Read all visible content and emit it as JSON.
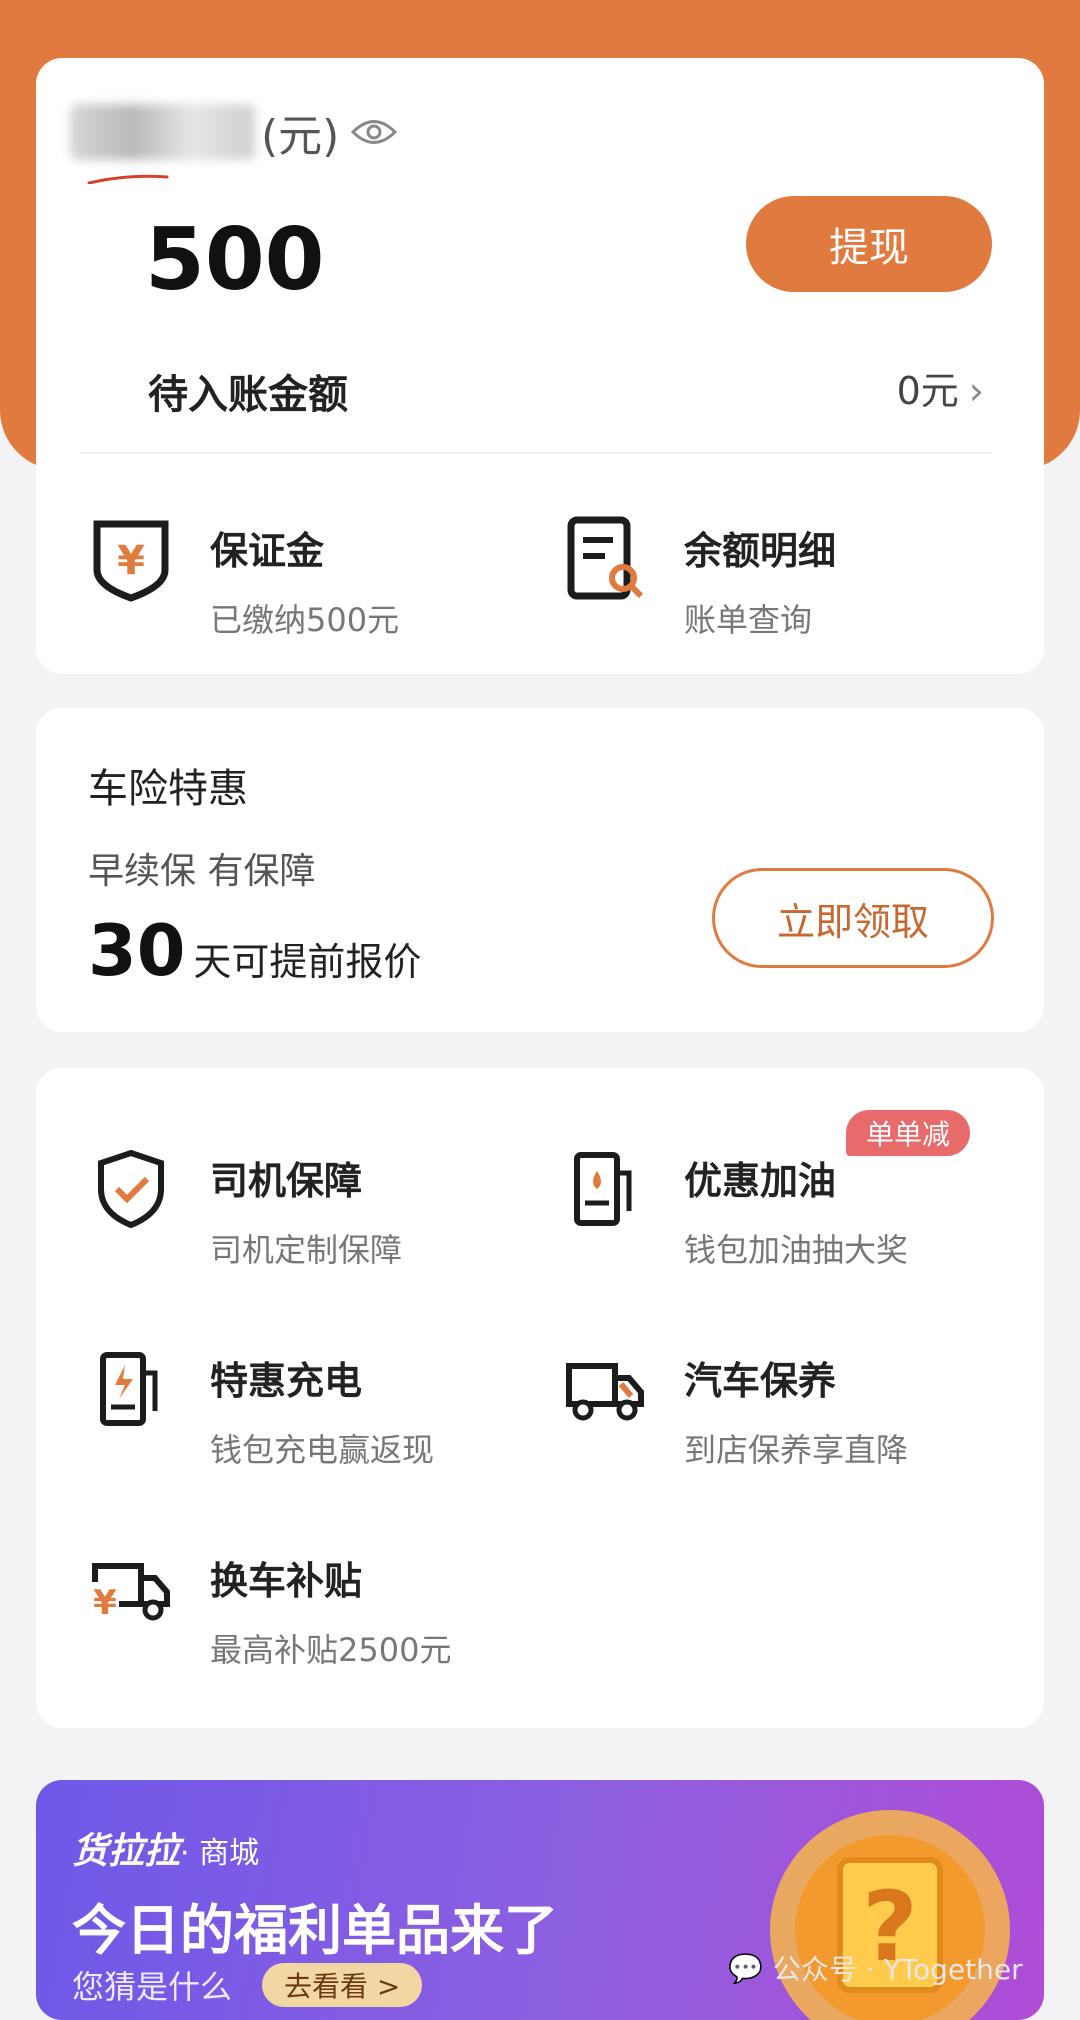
{
  "colors": {
    "accent": "#e07a3e",
    "badge": "#e86a6a",
    "banner_start": "#6f58e8",
    "banner_end": "#b14bd6"
  },
  "wallet": {
    "balance_label_suffix": "(元)",
    "balance": "500",
    "withdraw_label": "提现",
    "pending_label": "待入账金额",
    "pending_value": "0元",
    "deposit": {
      "title": "保证金",
      "subtitle": "已缴纳500元"
    },
    "details": {
      "title": "余额明细",
      "subtitle": "账单查询"
    }
  },
  "insurance": {
    "title": "车险特惠",
    "subtitle": "早续保 有保障",
    "days": "30",
    "days_text": "天可提前报价",
    "claim_label": "立即领取"
  },
  "services": {
    "badge": "单单减",
    "items": [
      {
        "title": "司机保障",
        "subtitle": "司机定制保障",
        "icon": "shield-check-icon"
      },
      {
        "title": "优惠加油",
        "subtitle": "钱包加油抽大奖",
        "icon": "fuel-pump-icon"
      },
      {
        "title": "特惠充电",
        "subtitle": "钱包充电赢返现",
        "icon": "charging-station-icon"
      },
      {
        "title": "汽车保养",
        "subtitle": "到店保养享直降",
        "icon": "truck-wrench-icon"
      },
      {
        "title": "换车补贴",
        "subtitle": "最高补贴2500元",
        "icon": "truck-yuan-icon"
      }
    ]
  },
  "banner": {
    "brand": "货拉拉",
    "brand_suffix": "· 商城",
    "title": "今日的福利单品来了",
    "subtitle": "您猜是什么",
    "cta": "去看看 >"
  },
  "watermark": {
    "text": "公众号 · YTogether"
  }
}
